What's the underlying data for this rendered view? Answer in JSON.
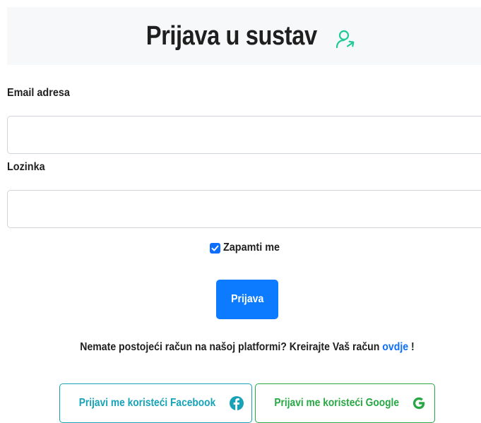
{
  "header": {
    "title": "Prijava u sustav",
    "icon": "user-login-icon"
  },
  "form": {
    "email_label": "Email adresa",
    "email_value": "",
    "password_label": "Lozinka",
    "password_value": "",
    "remember_label": "Zapamti me",
    "remember_checked": true,
    "submit_label": "Prijava"
  },
  "signup": {
    "text": "Nemate postojeći račun na našoj platformi? Kreirajte Vaš račun",
    "link_text": "ovdje",
    "suffix": "!"
  },
  "social": {
    "facebook_label": "Prijavi me koristeći Facebook",
    "google_label": "Prijavi me koristeći Google"
  },
  "colors": {
    "primary": "#0d7bff",
    "link": "#0d6efd",
    "facebook": "#17a2b8",
    "google": "#28a745",
    "header_bg": "#f7f8f9",
    "title_icon": "#20c997"
  }
}
